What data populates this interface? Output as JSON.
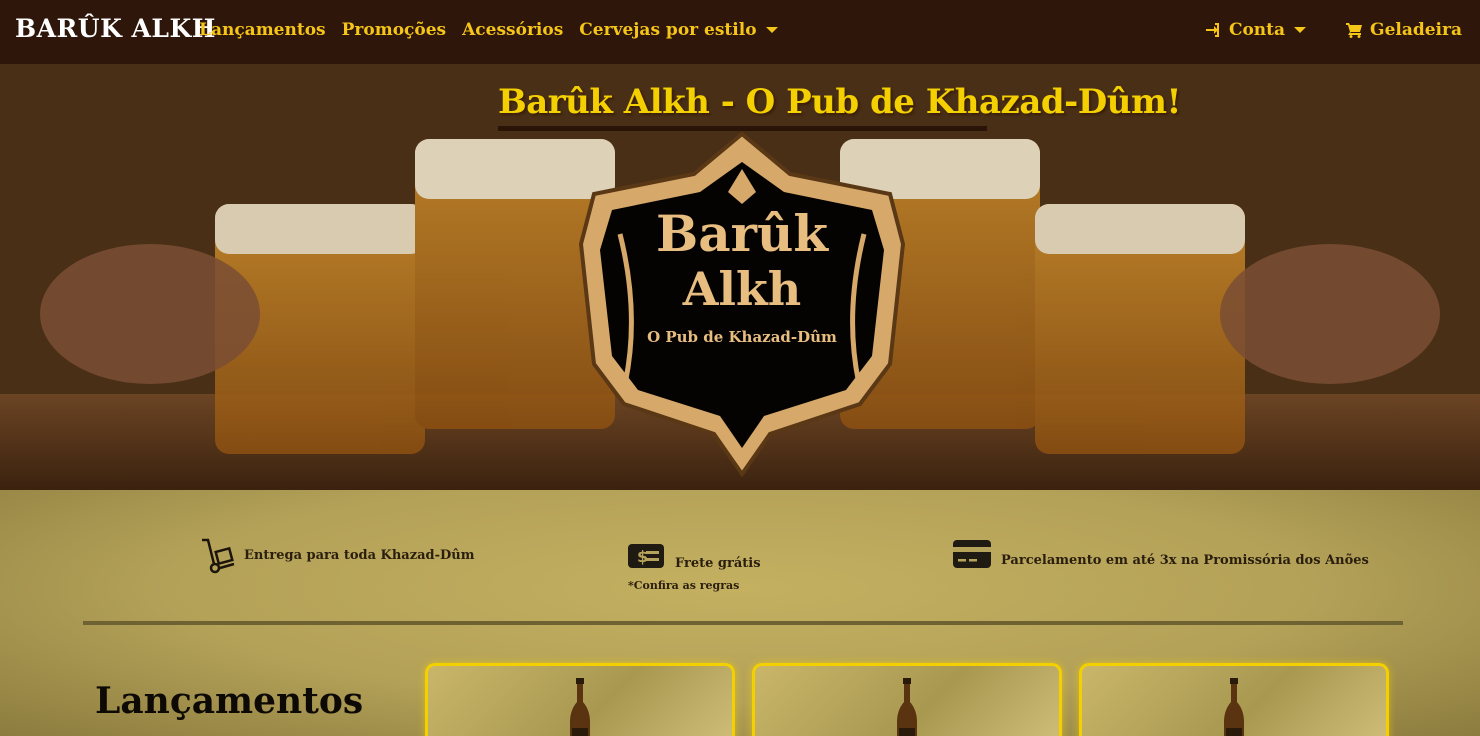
{
  "navbar": {
    "brand": "BARÛK ALKH",
    "links": [
      "Lançamentos",
      "Promoções",
      "Acessórios",
      "Cervejas por estilo"
    ],
    "account_label": "Conta",
    "cart_label": "Geladeira"
  },
  "hero": {
    "title": "Barûk Alkh - O Pub de Khazad-Dûm!",
    "emblem_line1": "Barûk",
    "emblem_line2": "Alkh",
    "emblem_subtitle": "O Pub de Khazad-Dûm"
  },
  "features": {
    "delivery": "Entrega para toda Khazad-Dûm",
    "shipping": "Frete grátis",
    "shipping_note": "*Confira as regras",
    "installments": "Parcelamento em até 3x na Promissória dos Anões"
  },
  "section": {
    "title": "Lançamentos"
  },
  "colors": {
    "navbar_bg": "#2e160a",
    "accent_gold": "#f5d000",
    "nav_link": "#f5c518",
    "body_bg": "#b6a45a"
  },
  "icons": {
    "account": "sign-in-icon",
    "cart": "shopping-cart-icon",
    "delivery": "hand-truck-icon",
    "shipping": "money-bill-icon",
    "installments": "credit-card-icon"
  }
}
